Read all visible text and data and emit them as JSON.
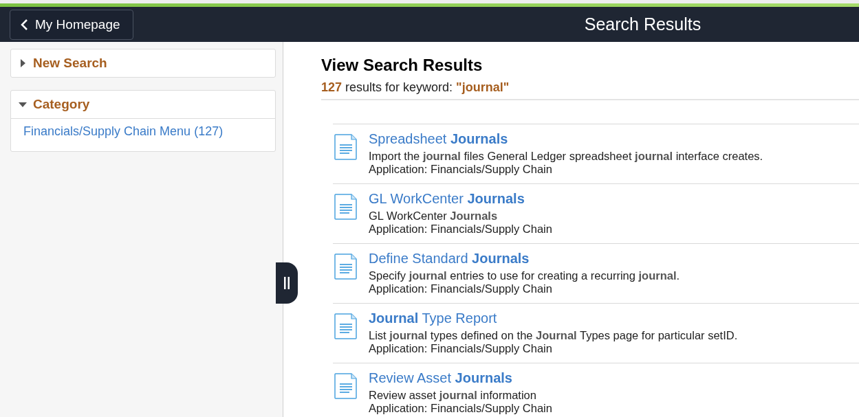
{
  "header": {
    "back_button": "My Homepage",
    "title": "Search Results"
  },
  "sidebar": {
    "sections": [
      {
        "title": "New Search",
        "expanded": false
      },
      {
        "title": "Category",
        "expanded": true,
        "items": [
          "Financials/Supply Chain Menu (127)"
        ]
      }
    ]
  },
  "results_panel": {
    "heading": "View Search Results",
    "summary": "**127** results for keyword: **\"journal\"**",
    "results": [
      {
        "title": "Spreadsheet **Journals**",
        "description": "Import the **journal** files General Ledger spreadsheet **journal** interface creates.",
        "application": "Application: Financials/Supply Chain"
      },
      {
        "title": "GL WorkCenter **Journals**",
        "description": "GL WorkCenter **Journals**",
        "application": "Application: Financials/Supply Chain"
      },
      {
        "title": "Define Standard **Journals**",
        "description": "Specify **journal** entries to use for creating a recurring **journal**.",
        "application": "Application: Financials/Supply Chain"
      },
      {
        "title": "**Journal** Type Report",
        "description": "List **journal** types defined on the **Journal** Types page for particular setID.",
        "application": "Application: Financials/Supply Chain"
      },
      {
        "title": "Review Asset **Journals**",
        "description": "Review asset **journal** information",
        "application": "Application: Financials/Supply Chain"
      }
    ]
  }
}
